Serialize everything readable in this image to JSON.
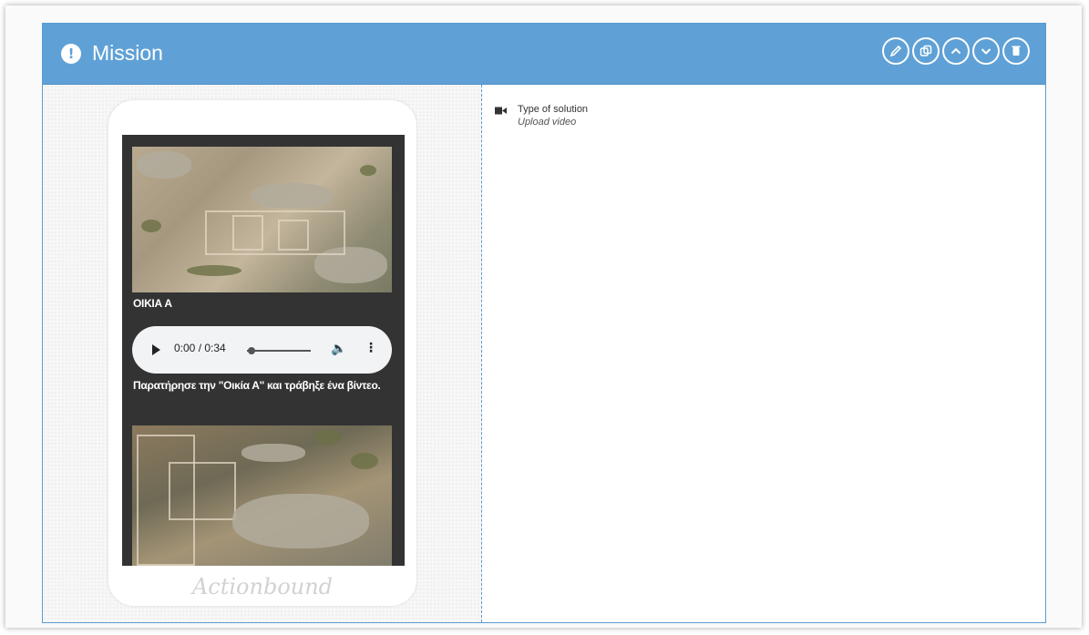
{
  "header": {
    "title": "Mission",
    "status_icon": "exclamation-circle-icon",
    "actions": [
      {
        "name": "edit-button",
        "icon": "pencil-icon"
      },
      {
        "name": "duplicate-button",
        "icon": "copy-icon"
      },
      {
        "name": "move-up-button",
        "icon": "chevron-up-icon"
      },
      {
        "name": "move-down-button",
        "icon": "chevron-down-icon"
      },
      {
        "name": "delete-button",
        "icon": "trash-icon"
      }
    ],
    "color": "#5fa1d6"
  },
  "preview": {
    "title": "ΟΙΚΙΑ Α",
    "audio": {
      "time": "0:00 / 0:34"
    },
    "instruction": "Παρατήρησε την \"Οικία Α\" και τράβηξε ένα βίντεο.",
    "brand": "Actionbound"
  },
  "solution": {
    "label": "Type of solution",
    "value": "Upload video",
    "icon": "video-camera-icon"
  }
}
